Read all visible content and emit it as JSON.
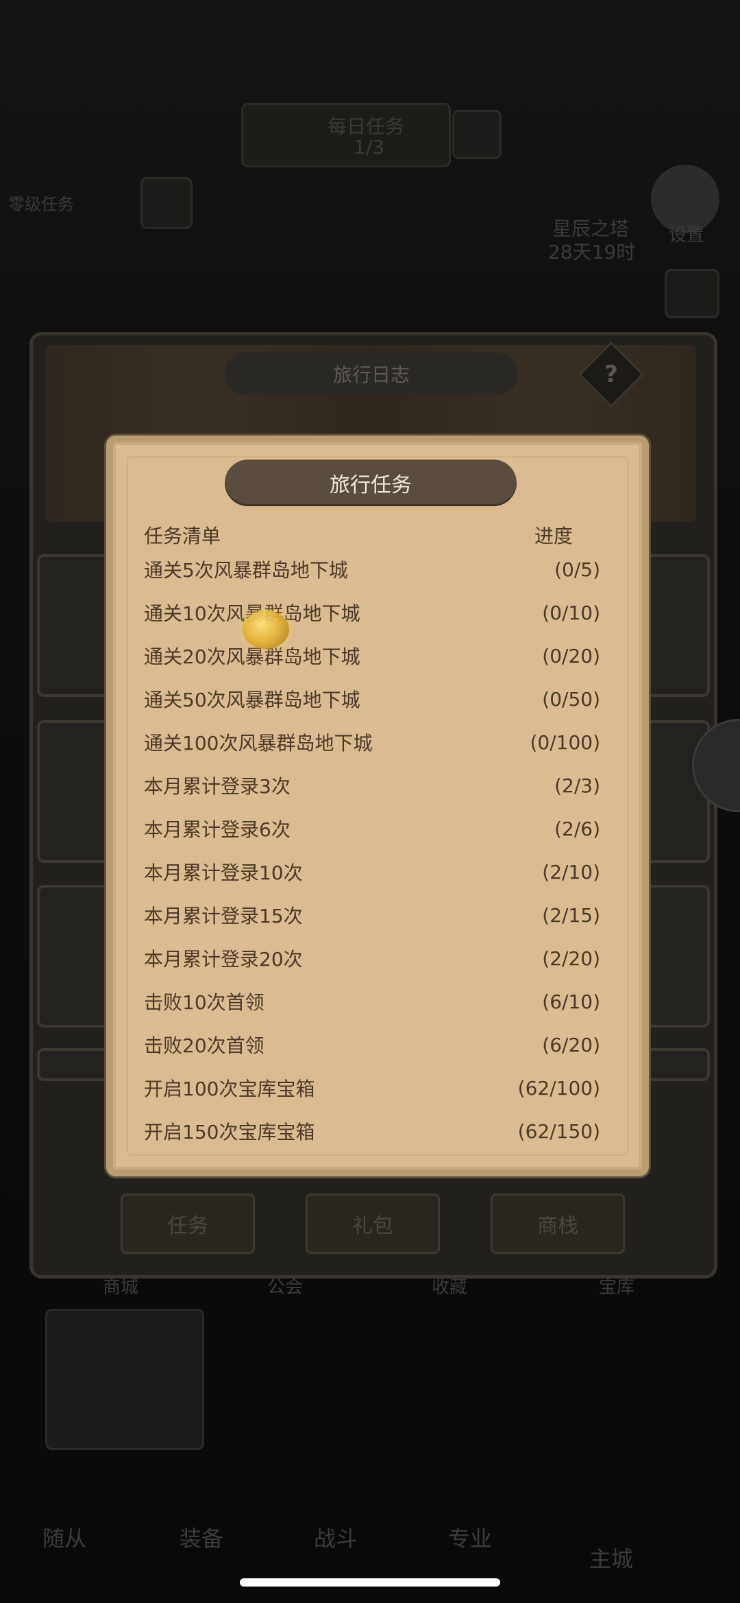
{
  "background": {
    "top_banner_line1": "每日任务",
    "top_banner_line2": "1/3",
    "left_label": "零级任务",
    "right_title": "星辰之塔",
    "right_timer": "28天19时",
    "settings_label": "设置"
  },
  "log_panel": {
    "title": "旅行日志",
    "help": "?",
    "tabs": [
      "任务",
      "礼包",
      "商栈"
    ],
    "sub_tabs": [
      "商城",
      "公会",
      "收藏",
      "宝库"
    ]
  },
  "bottom_nav": [
    "随从",
    "装备",
    "战斗",
    "专业",
    "主城"
  ],
  "dialog": {
    "title": "旅行任务",
    "header_left": "任务清单",
    "header_right": "进度",
    "tasks": [
      {
        "name": "通关5次风暴群岛地下城",
        "progress": "(0/5)"
      },
      {
        "name": "通关10次风暴群岛地下城",
        "progress": "(0/10)"
      },
      {
        "name": "通关20次风暴群岛地下城",
        "progress": "(0/20)"
      },
      {
        "name": "通关50次风暴群岛地下城",
        "progress": "(0/50)"
      },
      {
        "name": "通关100次风暴群岛地下城",
        "progress": "(0/100)"
      },
      {
        "name": "本月累计登录3次",
        "progress": "(2/3)"
      },
      {
        "name": "本月累计登录6次",
        "progress": "(2/6)"
      },
      {
        "name": "本月累计登录10次",
        "progress": "(2/10)"
      },
      {
        "name": "本月累计登录15次",
        "progress": "(2/15)"
      },
      {
        "name": "本月累计登录20次",
        "progress": "(2/20)"
      },
      {
        "name": "击败10次首领",
        "progress": "(6/10)"
      },
      {
        "name": "击败20次首领",
        "progress": "(6/20)"
      },
      {
        "name": "开启100次宝库宝箱",
        "progress": "(62/100)"
      },
      {
        "name": "开启150次宝库宝箱",
        "progress": "(62/150)"
      }
    ]
  }
}
